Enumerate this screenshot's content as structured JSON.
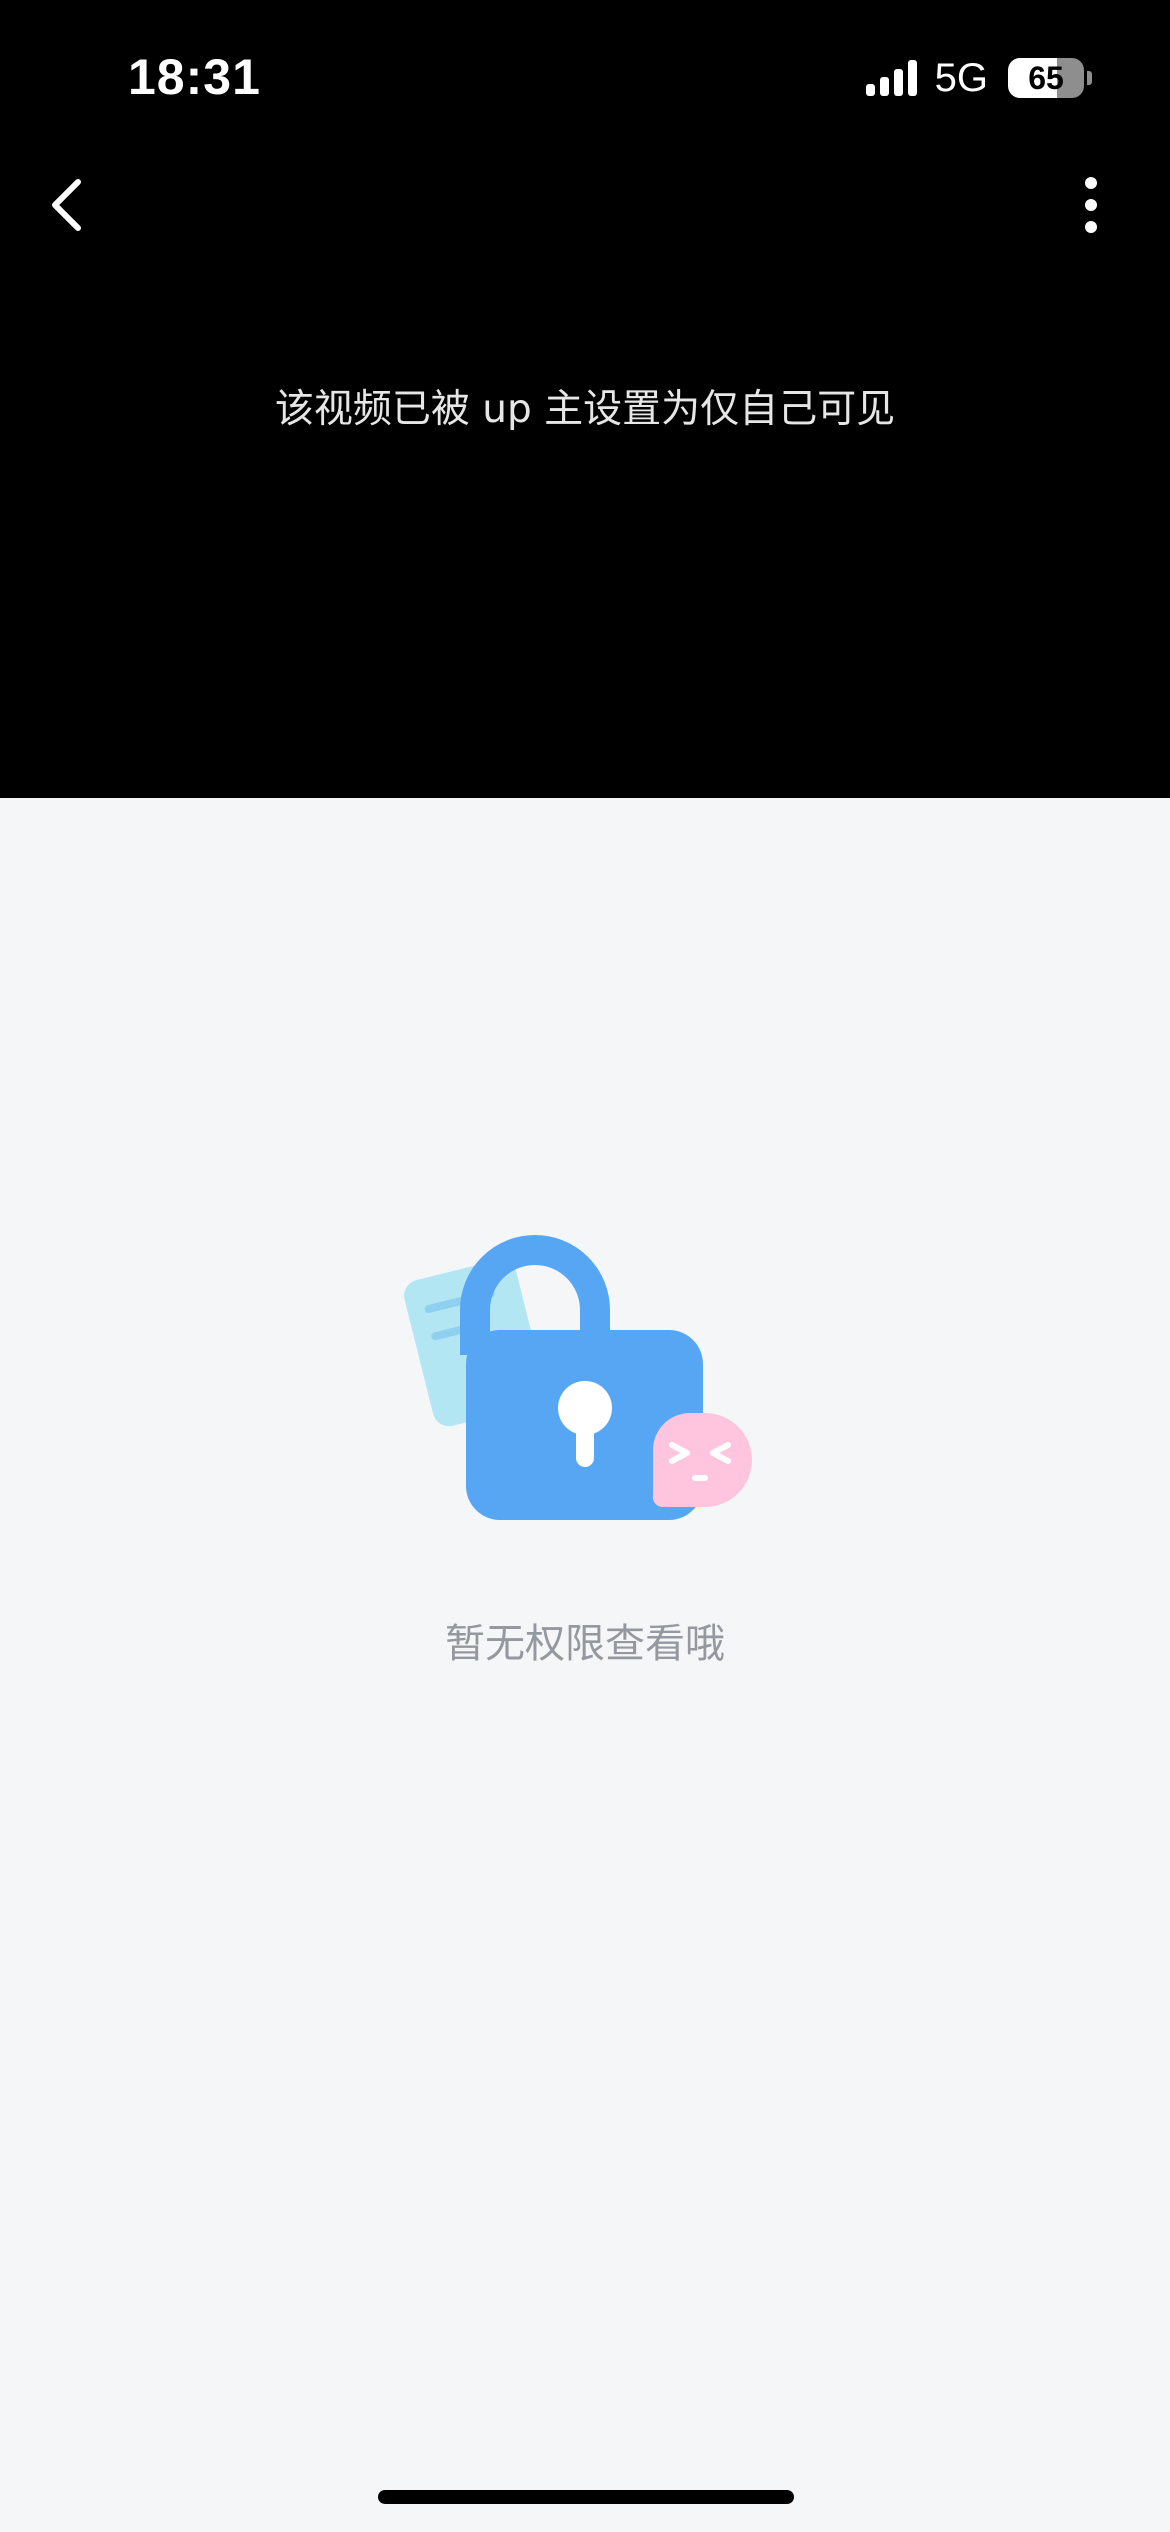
{
  "status_bar": {
    "time": "18:31",
    "network": "5G",
    "battery_level": "65",
    "battery_fraction": 0.65
  },
  "header": {
    "back_icon": "chevron-left-icon",
    "more_icon": "more-vertical-icon"
  },
  "player": {
    "message": "该视频已被 up 主设置为仅自己可见"
  },
  "empty_state": {
    "illustration": "lock-icon",
    "text": "暂无权限查看哦"
  },
  "colors": {
    "player_bg": "#000000",
    "page_bg": "#f5f6f8",
    "lock_blue": "#57a6f4",
    "note_cyan": "#b2e6f2",
    "bubble_pink": "#ffc5de",
    "secondary_text": "#9499a0"
  }
}
